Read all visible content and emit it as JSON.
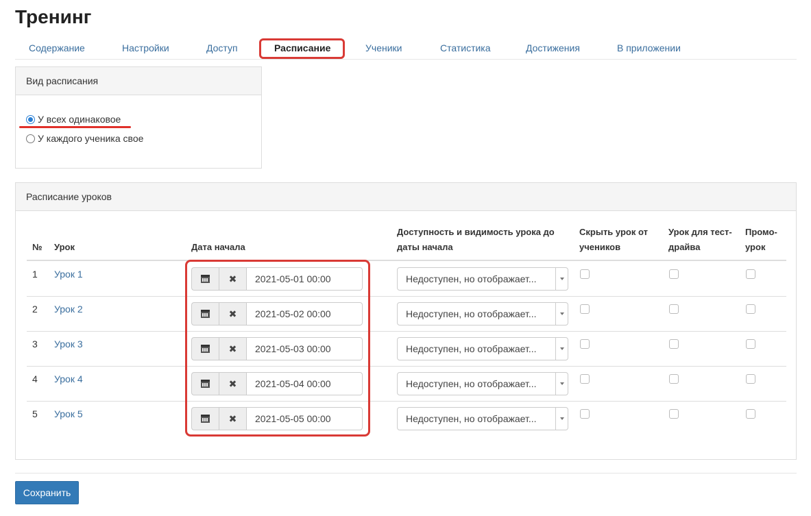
{
  "page": {
    "title": "Тренинг"
  },
  "tabs": [
    {
      "label": "Содержание"
    },
    {
      "label": "Настройки"
    },
    {
      "label": "Доступ"
    },
    {
      "label": "Расписание",
      "active": true
    },
    {
      "label": "Ученики"
    },
    {
      "label": "Статистика"
    },
    {
      "label": "Достижения"
    },
    {
      "label": "В приложении"
    }
  ],
  "schedule_type": {
    "title": "Вид расписания",
    "options": [
      {
        "label": "У всех одинаковое",
        "selected": true
      },
      {
        "label": "У каждого ученика свое",
        "selected": false
      }
    ]
  },
  "lessons_schedule": {
    "title": "Расписание уроков",
    "columns": {
      "num": "№",
      "lesson": "Урок",
      "start_date": "Дата начала",
      "availability_line1": "Доступность и видимость урока до",
      "availability_line2": "даты начала",
      "hide_line1": "Скрыть урок от",
      "hide_line2": "учеников",
      "test_line1": "Урок для тест-",
      "test_line2": "драйва",
      "promo_line1": "Промо-",
      "promo_line2": "урок"
    },
    "rows": [
      {
        "num": "1",
        "lesson": "Урок 1",
        "start_date": "2021-05-01 00:00",
        "availability": "Недоступен, но отображает...",
        "hide": false,
        "test_drive": false,
        "promo": false
      },
      {
        "num": "2",
        "lesson": "Урок 2",
        "start_date": "2021-05-02 00:00",
        "availability": "Недоступен, но отображает...",
        "hide": false,
        "test_drive": false,
        "promo": false
      },
      {
        "num": "3",
        "lesson": "Урок 3",
        "start_date": "2021-05-03 00:00",
        "availability": "Недоступен, но отображает...",
        "hide": false,
        "test_drive": false,
        "promo": false
      },
      {
        "num": "4",
        "lesson": "Урок 4",
        "start_date": "2021-05-04 00:00",
        "availability": "Недоступен, но отображает...",
        "hide": false,
        "test_drive": false,
        "promo": false
      },
      {
        "num": "5",
        "lesson": "Урок 5",
        "start_date": "2021-05-05 00:00",
        "availability": "Недоступен, но отображает...",
        "hide": false,
        "test_drive": false,
        "promo": false
      }
    ]
  },
  "icons": {
    "calendar": "calendar-icon",
    "clear": "times-icon",
    "dropdown": "chevron-down-icon"
  },
  "colors": {
    "link": "#3a6e9e",
    "primary_button": "#337ab7",
    "highlight": "#d93a35"
  },
  "footer": {
    "save_label": "Сохранить"
  }
}
